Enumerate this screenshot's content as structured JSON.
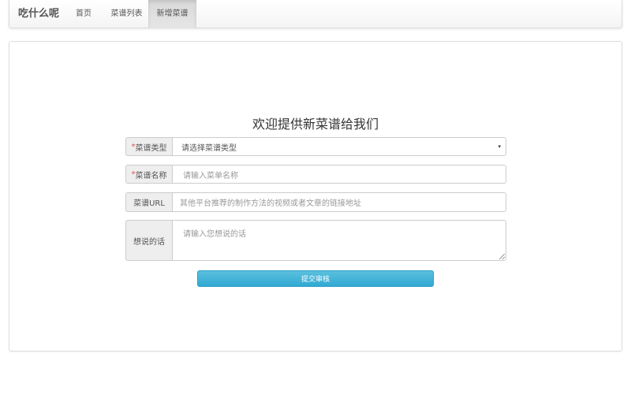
{
  "navbar": {
    "brand": "吃什么呢",
    "items": [
      {
        "label": "首页",
        "active": false
      },
      {
        "label": "菜谱列表",
        "active": false
      },
      {
        "label": "新增菜谱",
        "active": true
      }
    ]
  },
  "form": {
    "title": "欢迎提供新菜谱给我们",
    "fields": {
      "type": {
        "required_mark": "*",
        "label": "菜谱类型",
        "value": "请选择菜谱类型",
        "caret": "▾"
      },
      "name": {
        "required_mark": "*",
        "label": "菜谱名称",
        "placeholder": "请输入菜单名称"
      },
      "url": {
        "label": "菜谱URL",
        "placeholder": "其他平台推荐的制作方法的视频或者文章的链接地址"
      },
      "comment": {
        "label": "想说的话",
        "placeholder": "请输入您想说的话"
      }
    },
    "submit_label": "提交审核"
  },
  "colors": {
    "primary_button": "#31a9d3",
    "required_mark": "#d9534f",
    "addon_background": "#eeeeee"
  }
}
